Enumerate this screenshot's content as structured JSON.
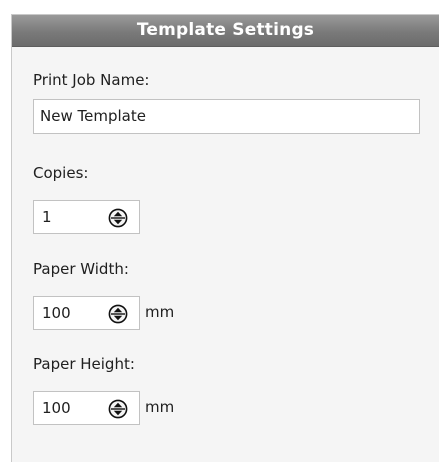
{
  "panel": {
    "title": "Template Settings"
  },
  "fields": {
    "job_name": {
      "label": "Print Job Name:",
      "value": "New Template"
    },
    "copies": {
      "label": "Copies:",
      "value": "1"
    },
    "paper_width": {
      "label": "Paper Width:",
      "value": "100",
      "unit": "mm"
    },
    "paper_height": {
      "label": "Paper Height:",
      "value": "100",
      "unit": "mm"
    }
  },
  "icons": {
    "spinner": "up-down-spinner-icon"
  }
}
